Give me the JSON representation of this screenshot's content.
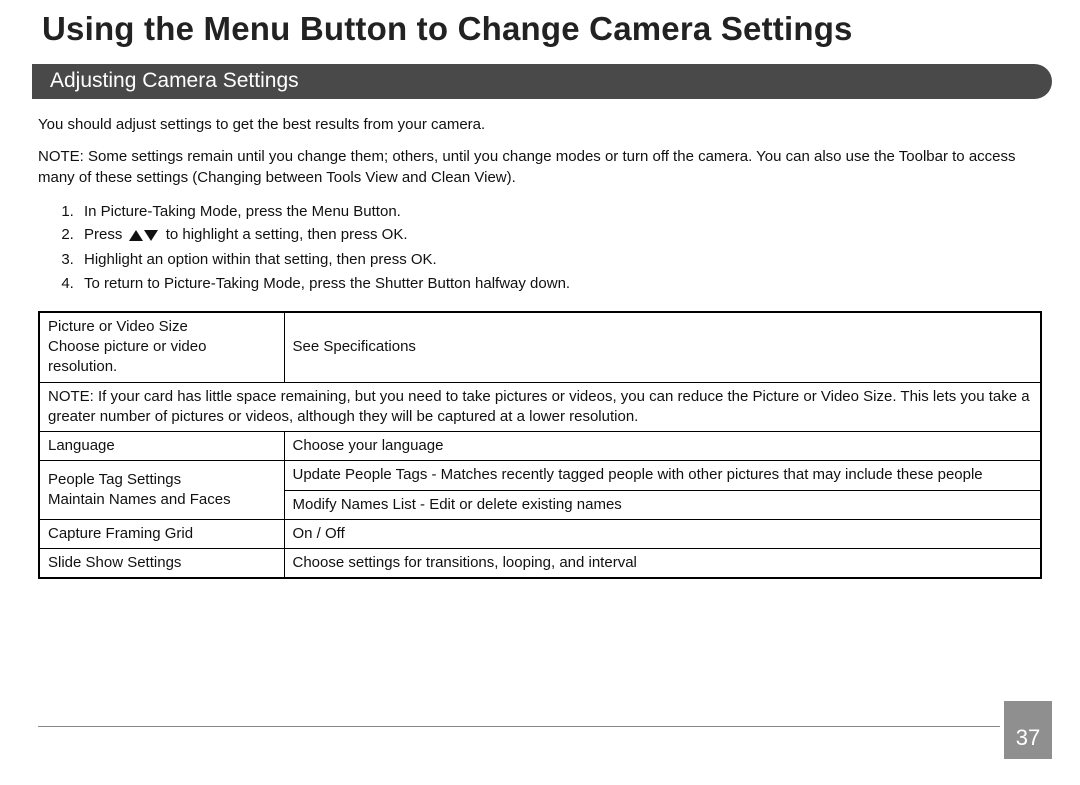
{
  "title": "Using the Menu Button to Change Camera Settings",
  "section_heading": "Adjusting Camera Settings",
  "intro": "You should adjust settings to get the best results from your camera.",
  "note": "NOTE: Some settings remain until you change them; others, until you change modes or turn off the camera. You can also use the Toolbar to access many of these settings (Changing between Tools View and Clean View).",
  "steps": {
    "s1": "In Picture-Taking Mode, press the Menu Button.",
    "s2a": "Press",
    "s2b": "to highlight a setting, then press OK.",
    "s3": "Highlight an option within that setting, then press OK.",
    "s4": "To return to Picture-Taking Mode, press the Shutter Button halfway down."
  },
  "table": {
    "row1": {
      "label_title": "Picture or Video Size",
      "label_sub": "Choose picture or video resolution.",
      "value": "See Specifications"
    },
    "note_row": "NOTE: If your card has little space remaining, but you need to take pictures or videos, you can reduce the Picture or Video Size. This lets you take a greater number of pictures or videos, although they will be captured at a lower resolution.",
    "row2": {
      "label": "Language",
      "value": "Choose your language"
    },
    "row3": {
      "label_title": "People Tag Settings",
      "label_sub": "Maintain Names and Faces",
      "value_a": "Update People Tags - Matches recently tagged people with other pictures that may include these people",
      "value_b": "Modify Names List - Edit or delete existing names"
    },
    "row4": {
      "label": "Capture Framing Grid",
      "value": "On / Off"
    },
    "row5": {
      "label": "Slide Show Settings",
      "value": "Choose settings for transitions, looping, and interval"
    }
  },
  "page_number": "37"
}
